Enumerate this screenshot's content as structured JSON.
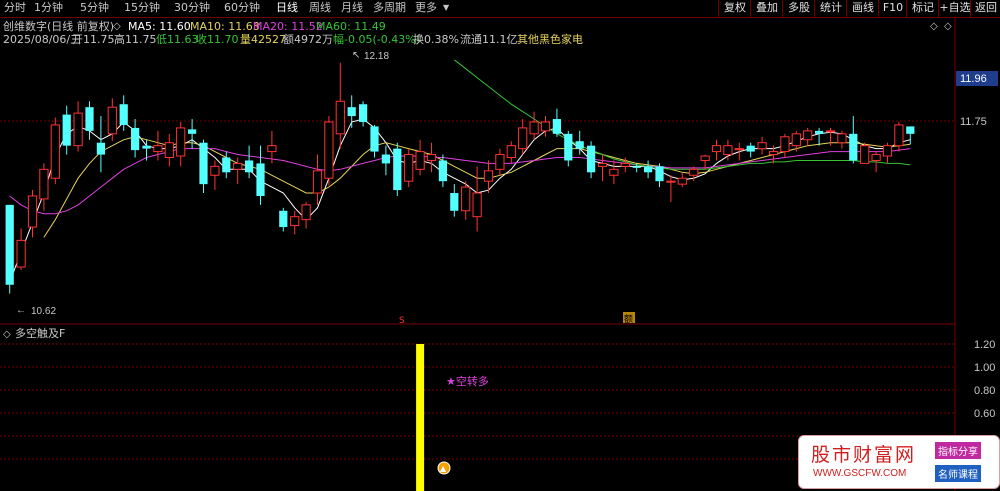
{
  "toolbar": {
    "left_items": [
      "分时",
      "1分钟",
      "5分钟",
      "15分钟",
      "30分钟",
      "60分钟",
      "日线",
      "周线",
      "月线",
      "多周期",
      "更多"
    ],
    "active": "日线",
    "right_items": [
      "复权",
      "叠加",
      "多股",
      "统计",
      "画线",
      "F10",
      "标记",
      "+自选",
      "返回"
    ]
  },
  "header": {
    "stock": "创维数字(日线 前复权)",
    "ma5": "MA5: 11.60",
    "ma10": "MA10: 11.63",
    "ma20": "MA20: 11.52",
    "ma60": "MA60: 11.49",
    "ma5_color": "#ffffff",
    "ma10_color": "#e6d35a",
    "ma20_color": "#e040e0",
    "ma60_color": "#35c435"
  },
  "infobar": {
    "date": "2025/08/06/三",
    "open": "开11.75",
    "high": "高11.75",
    "low": "低11.63",
    "close": "收11.70",
    "volume": "量42527",
    "amount": "额4972万",
    "change": "幅-0.05(-0.43%)",
    "turnover": "换0.38%",
    "float": "流通11.1亿",
    "sector": "其他黑色家电"
  },
  "axis": {
    "price_current": "11.96",
    "price_tick": "11.75",
    "high_marker": "12.18",
    "low_marker": "10.62",
    "sub_ticks": [
      "1.20",
      "1.00",
      "0.80",
      "0.60"
    ]
  },
  "markers": {
    "s_label": "S",
    "flag_label": "额"
  },
  "indicator": {
    "name": "多空触及F",
    "signal_text": "★空转多",
    "signal_color": "#e040e0",
    "bar_color": "#ffff00"
  },
  "watermark": {
    "title": "股市财富网",
    "url": "WWW.GSCFW.COM",
    "tag1": "指标分享",
    "tag2": "名师课程"
  },
  "chart_data": {
    "type": "candlestick",
    "colors": {
      "up": "#ff3232",
      "down": "#54ffff"
    },
    "candles": [
      {
        "o": 11.22,
        "h": 11.22,
        "l": 10.62,
        "c": 10.68
      },
      {
        "o": 10.8,
        "h": 11.06,
        "l": 10.78,
        "c": 10.98
      },
      {
        "o": 11.07,
        "h": 11.32,
        "l": 11.0,
        "c": 11.28
      },
      {
        "o": 11.26,
        "h": 11.5,
        "l": 11.18,
        "c": 11.46
      },
      {
        "o": 11.4,
        "h": 11.81,
        "l": 11.36,
        "c": 11.76
      },
      {
        "o": 11.83,
        "h": 11.89,
        "l": 11.56,
        "c": 11.62
      },
      {
        "o": 11.62,
        "h": 11.92,
        "l": 11.58,
        "c": 11.84
      },
      {
        "o": 11.88,
        "h": 11.92,
        "l": 11.66,
        "c": 11.72
      },
      {
        "o": 11.64,
        "h": 11.82,
        "l": 11.44,
        "c": 11.56
      },
      {
        "o": 11.7,
        "h": 11.94,
        "l": 11.65,
        "c": 11.88
      },
      {
        "o": 11.9,
        "h": 11.96,
        "l": 11.72,
        "c": 11.76
      },
      {
        "o": 11.74,
        "h": 11.8,
        "l": 11.54,
        "c": 11.59
      },
      {
        "o": 11.62,
        "h": 11.66,
        "l": 11.52,
        "c": 11.6
      },
      {
        "o": 11.58,
        "h": 11.72,
        "l": 11.52,
        "c": 11.62
      },
      {
        "o": 11.54,
        "h": 11.7,
        "l": 11.48,
        "c": 11.64
      },
      {
        "o": 11.55,
        "h": 11.78,
        "l": 11.48,
        "c": 11.74
      },
      {
        "o": 11.73,
        "h": 11.8,
        "l": 11.6,
        "c": 11.7
      },
      {
        "o": 11.64,
        "h": 11.66,
        "l": 11.3,
        "c": 11.36
      },
      {
        "o": 11.42,
        "h": 11.52,
        "l": 11.32,
        "c": 11.48
      },
      {
        "o": 11.54,
        "h": 11.58,
        "l": 11.4,
        "c": 11.44
      },
      {
        "o": 11.46,
        "h": 11.54,
        "l": 11.36,
        "c": 11.5
      },
      {
        "o": 11.52,
        "h": 11.62,
        "l": 11.4,
        "c": 11.44
      },
      {
        "o": 11.5,
        "h": 11.62,
        "l": 11.22,
        "c": 11.28
      },
      {
        "o": 11.58,
        "h": 11.72,
        "l": 11.5,
        "c": 11.62
      },
      {
        "o": 11.18,
        "h": 11.2,
        "l": 11.04,
        "c": 11.07
      },
      {
        "o": 11.08,
        "h": 11.18,
        "l": 11.02,
        "c": 11.14
      },
      {
        "o": 11.12,
        "h": 11.24,
        "l": 11.06,
        "c": 11.22
      },
      {
        "o": 11.3,
        "h": 11.56,
        "l": 11.22,
        "c": 11.45
      },
      {
        "o": 11.4,
        "h": 11.82,
        "l": 11.35,
        "c": 11.78
      },
      {
        "o": 11.7,
        "h": 12.18,
        "l": 11.6,
        "c": 11.92
      },
      {
        "o": 11.88,
        "h": 11.96,
        "l": 11.74,
        "c": 11.82
      },
      {
        "o": 11.9,
        "h": 11.92,
        "l": 11.75,
        "c": 11.78
      },
      {
        "o": 11.75,
        "h": 11.76,
        "l": 11.54,
        "c": 11.58
      },
      {
        "o": 11.56,
        "h": 11.62,
        "l": 11.42,
        "c": 11.5
      },
      {
        "o": 11.6,
        "h": 11.64,
        "l": 11.28,
        "c": 11.32
      },
      {
        "o": 11.38,
        "h": 11.6,
        "l": 11.34,
        "c": 11.56
      },
      {
        "o": 11.46,
        "h": 11.66,
        "l": 11.42,
        "c": 11.58
      },
      {
        "o": 11.52,
        "h": 11.64,
        "l": 11.44,
        "c": 11.56
      },
      {
        "o": 11.52,
        "h": 11.56,
        "l": 11.34,
        "c": 11.38
      },
      {
        "o": 11.3,
        "h": 11.36,
        "l": 11.14,
        "c": 11.18
      },
      {
        "o": 11.18,
        "h": 11.38,
        "l": 11.12,
        "c": 11.34
      },
      {
        "o": 11.14,
        "h": 11.48,
        "l": 11.04,
        "c": 11.3
      },
      {
        "o": 11.38,
        "h": 11.52,
        "l": 11.3,
        "c": 11.45
      },
      {
        "o": 11.46,
        "h": 11.6,
        "l": 11.42,
        "c": 11.56
      },
      {
        "o": 11.54,
        "h": 11.65,
        "l": 11.5,
        "c": 11.62
      },
      {
        "o": 11.6,
        "h": 11.8,
        "l": 11.56,
        "c": 11.74
      },
      {
        "o": 11.7,
        "h": 11.85,
        "l": 11.66,
        "c": 11.78
      },
      {
        "o": 11.72,
        "h": 11.82,
        "l": 11.68,
        "c": 11.78
      },
      {
        "o": 11.8,
        "h": 11.87,
        "l": 11.68,
        "c": 11.7
      },
      {
        "o": 11.7,
        "h": 11.72,
        "l": 11.48,
        "c": 11.52
      },
      {
        "o": 11.65,
        "h": 11.72,
        "l": 11.56,
        "c": 11.6
      },
      {
        "o": 11.62,
        "h": 11.65,
        "l": 11.4,
        "c": 11.44
      },
      {
        "o": 11.48,
        "h": 11.56,
        "l": 11.38,
        "c": 11.5
      },
      {
        "o": 11.42,
        "h": 11.52,
        "l": 11.36,
        "c": 11.46
      },
      {
        "o": 11.48,
        "h": 11.54,
        "l": 11.44,
        "c": 11.5
      },
      {
        "o": 11.48,
        "h": 11.5,
        "l": 11.44,
        "c": 11.47
      },
      {
        "o": 11.48,
        "h": 11.52,
        "l": 11.4,
        "c": 11.44
      },
      {
        "o": 11.48,
        "h": 11.5,
        "l": 11.34,
        "c": 11.38
      },
      {
        "o": 11.38,
        "h": 11.42,
        "l": 11.24,
        "c": 11.38
      },
      {
        "o": 11.36,
        "h": 11.44,
        "l": 11.34,
        "c": 11.4
      },
      {
        "o": 11.42,
        "h": 11.48,
        "l": 11.38,
        "c": 11.46
      },
      {
        "o": 11.52,
        "h": 11.56,
        "l": 11.46,
        "c": 11.55
      },
      {
        "o": 11.58,
        "h": 11.66,
        "l": 11.52,
        "c": 11.62
      },
      {
        "o": 11.56,
        "h": 11.66,
        "l": 11.52,
        "c": 11.62
      },
      {
        "o": 11.6,
        "h": 11.64,
        "l": 11.52,
        "c": 11.6
      },
      {
        "o": 11.62,
        "h": 11.64,
        "l": 11.54,
        "c": 11.58
      },
      {
        "o": 11.6,
        "h": 11.68,
        "l": 11.56,
        "c": 11.64
      },
      {
        "o": 11.56,
        "h": 11.62,
        "l": 11.5,
        "c": 11.58
      },
      {
        "o": 11.58,
        "h": 11.7,
        "l": 11.54,
        "c": 11.68
      },
      {
        "o": 11.62,
        "h": 11.72,
        "l": 11.58,
        "c": 11.7
      },
      {
        "o": 11.66,
        "h": 11.74,
        "l": 11.62,
        "c": 11.72
      },
      {
        "o": 11.72,
        "h": 11.74,
        "l": 11.62,
        "c": 11.7
      },
      {
        "o": 11.72,
        "h": 11.74,
        "l": 11.62,
        "c": 11.72
      },
      {
        "o": 11.64,
        "h": 11.72,
        "l": 11.6,
        "c": 11.7
      },
      {
        "o": 11.7,
        "h": 11.82,
        "l": 11.5,
        "c": 11.52
      },
      {
        "o": 11.5,
        "h": 11.64,
        "l": 11.5,
        "c": 11.62
      },
      {
        "o": 11.52,
        "h": 11.58,
        "l": 11.44,
        "c": 11.56
      },
      {
        "o": 11.55,
        "h": 11.64,
        "l": 11.5,
        "c": 11.62
      },
      {
        "o": 11.62,
        "h": 11.78,
        "l": 11.58,
        "c": 11.76
      },
      {
        "o": 11.75,
        "h": 11.75,
        "l": 11.63,
        "c": 11.7
      }
    ],
    "ma": [
      {
        "name": "MA5",
        "color": "#ffffff",
        "values": [
          10.7,
          10.9,
          11.1,
          11.3,
          11.55,
          11.7,
          11.75,
          11.72,
          11.66,
          11.7,
          11.78,
          11.72,
          11.62,
          11.6,
          11.6,
          11.62,
          11.66,
          11.6,
          11.54,
          11.46,
          11.46,
          11.46,
          11.38,
          11.34,
          11.3,
          11.2,
          11.12,
          11.2,
          11.4,
          11.62,
          11.78,
          11.8,
          11.74,
          11.64,
          11.52,
          11.5,
          11.52,
          11.5,
          11.44,
          11.4,
          11.36,
          11.3,
          11.32,
          11.4,
          11.46,
          11.56,
          11.66,
          11.72,
          11.74,
          11.66,
          11.6,
          11.52,
          11.5,
          11.48,
          11.48,
          11.48,
          11.48,
          11.45,
          11.41,
          11.39,
          11.4,
          11.43,
          11.5,
          11.55,
          11.58,
          11.6,
          11.6,
          11.6,
          11.62,
          11.65,
          11.68,
          11.7,
          11.71,
          11.7,
          11.66,
          11.62,
          11.6,
          11.6,
          11.64,
          11.66
        ]
      },
      {
        "name": "MA10",
        "color": "#e6d35a",
        "values": [
          null,
          null,
          null,
          11.0,
          11.12,
          11.26,
          11.4,
          11.5,
          11.58,
          11.62,
          11.66,
          11.68,
          11.66,
          11.64,
          11.62,
          11.64,
          11.64,
          11.62,
          11.58,
          11.54,
          11.5,
          11.48,
          11.46,
          11.42,
          11.38,
          11.34,
          11.3,
          11.3,
          11.34,
          11.4,
          11.48,
          11.56,
          11.62,
          11.64,
          11.62,
          11.6,
          11.58,
          11.56,
          11.52,
          11.48,
          11.44,
          11.4,
          11.4,
          11.42,
          11.44,
          11.48,
          11.52,
          11.56,
          11.6,
          11.6,
          11.6,
          11.58,
          11.56,
          11.54,
          11.52,
          11.5,
          11.49,
          11.48,
          11.46,
          11.44,
          11.43,
          11.44,
          11.46,
          11.48,
          11.5,
          11.52,
          11.54,
          11.56,
          11.58,
          11.6,
          11.62,
          11.63,
          11.64,
          11.64,
          11.64,
          11.63,
          11.62,
          11.61,
          11.62,
          11.63
        ]
      },
      {
        "name": "MA20",
        "color": "#e040e0",
        "values": [
          11.28,
          11.22,
          11.18,
          11.16,
          11.16,
          11.18,
          11.22,
          11.28,
          11.34,
          11.4,
          11.46,
          11.5,
          11.54,
          11.56,
          11.58,
          11.6,
          11.6,
          11.6,
          11.6,
          11.58,
          11.56,
          11.55,
          11.54,
          11.53,
          11.52,
          11.5,
          11.48,
          11.46,
          11.45,
          11.46,
          11.48,
          11.5,
          11.52,
          11.54,
          11.55,
          11.55,
          11.55,
          11.54,
          11.54,
          11.53,
          11.52,
          11.51,
          11.5,
          11.5,
          11.5,
          11.51,
          11.52,
          11.53,
          11.54,
          11.54,
          11.54,
          11.53,
          11.52,
          11.51,
          11.5,
          11.49,
          11.48,
          11.48,
          11.47,
          11.47,
          11.47,
          11.47,
          11.48,
          11.49,
          11.5,
          11.51,
          11.52,
          11.53,
          11.54,
          11.55,
          11.56,
          11.57,
          11.58,
          11.58,
          11.58,
          11.58,
          11.58,
          11.58,
          11.59,
          11.6
        ]
      },
      {
        "name": "MA60",
        "color": "#35c435",
        "values": [
          null,
          null,
          null,
          null,
          null,
          null,
          null,
          null,
          null,
          null,
          null,
          null,
          null,
          null,
          null,
          null,
          null,
          null,
          null,
          null,
          null,
          null,
          null,
          null,
          null,
          null,
          null,
          null,
          null,
          null,
          null,
          null,
          null,
          null,
          null,
          null,
          null,
          null,
          null,
          12.2,
          12.14,
          12.08,
          12.02,
          11.96,
          11.9,
          11.85,
          11.8,
          11.75,
          11.7,
          11.66,
          11.62,
          11.59,
          11.56,
          11.53,
          11.51,
          11.49,
          11.48,
          11.47,
          11.46,
          11.46,
          11.46,
          11.46,
          11.47,
          11.48,
          11.49,
          11.5,
          11.5,
          11.51,
          11.51,
          11.52,
          11.52,
          11.52,
          11.52,
          11.52,
          11.52,
          11.51,
          11.51,
          11.5,
          11.5,
          11.49
        ]
      }
    ],
    "ylim": [
      10.55,
      12.28
    ],
    "sub_chart": {
      "type": "bar",
      "ylim": [
        0.42,
        1.24
      ],
      "signal_index": 36,
      "value": 1.2
    }
  }
}
